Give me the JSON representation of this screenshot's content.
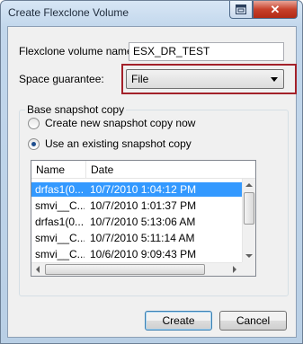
{
  "window": {
    "title": "Create Flexclone Volume",
    "close_glyph": "✕"
  },
  "form": {
    "volume_name_label": "Flexclone volume name:",
    "volume_name_value": "ESX_DR_TEST",
    "space_guarantee_label": "Space guarantee:",
    "space_guarantee_value": "File"
  },
  "snapshot_group": {
    "title": "Base snapshot copy",
    "option_new": "Create new snapshot copy now",
    "option_existing": "Use an existing snapshot copy",
    "selected_option": "existing"
  },
  "snapshot_list": {
    "columns": [
      "Name",
      "Date"
    ],
    "rows": [
      {
        "name": "drfas1(0...",
        "date": "10/7/2010 1:04:12 PM",
        "selected": true
      },
      {
        "name": "smvi__C...",
        "date": "10/7/2010 1:01:37 PM",
        "selected": false
      },
      {
        "name": "drfas1(0...",
        "date": "10/7/2010 5:13:06 AM",
        "selected": false
      },
      {
        "name": "smvi__C...",
        "date": "10/7/2010 5:11:14 AM",
        "selected": false
      },
      {
        "name": "smvi__C...",
        "date": "10/6/2010 9:09:43 PM",
        "selected": false
      }
    ]
  },
  "buttons": {
    "create": "Create",
    "cancel": "Cancel"
  },
  "colors": {
    "highlight_border": "#a3212a",
    "selection": "#3399ff"
  }
}
